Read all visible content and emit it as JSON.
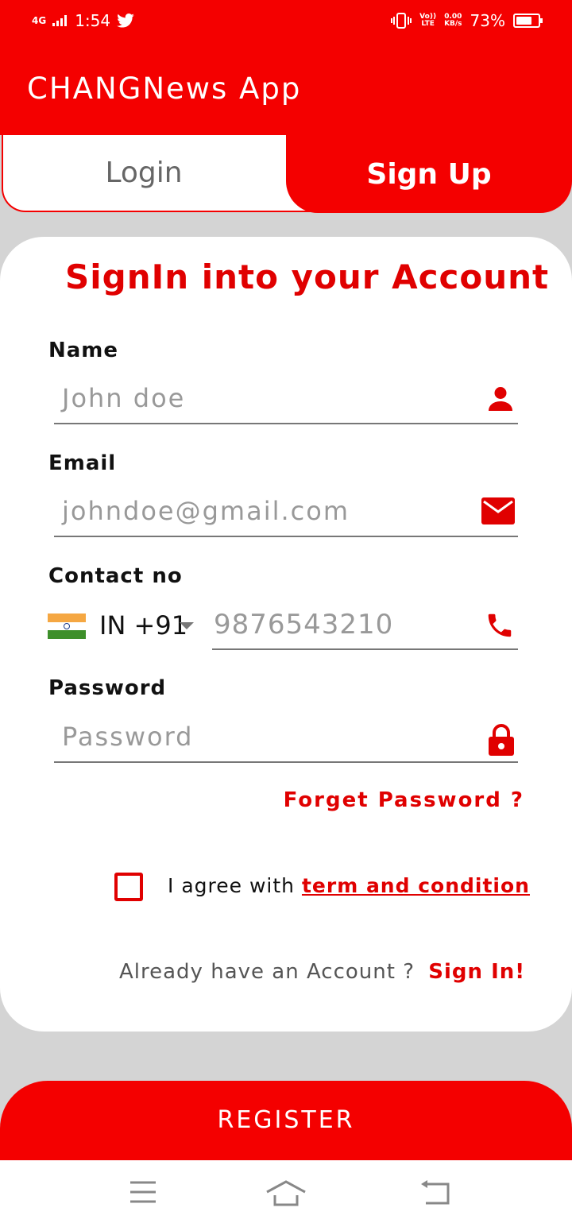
{
  "status_bar": {
    "network": "4G",
    "time": "1:54",
    "volte_top": "Vo))",
    "volte_bottom": "LTE",
    "speed_top": "0.00",
    "speed_bottom": "KB/s",
    "battery": "73%",
    "battery_level": 0.73
  },
  "app": {
    "title": "CHANGNews App"
  },
  "tabs": [
    {
      "label": "Login"
    },
    {
      "label": "Sign Up"
    }
  ],
  "form": {
    "title": "SignIn into your Account",
    "name": {
      "label": "Name",
      "placeholder": "John doe"
    },
    "email": {
      "label": "Email",
      "placeholder": "johndoe@gmail.com"
    },
    "contact": {
      "label": "Contact no",
      "country_code": "IN +91",
      "placeholder": "9876543210"
    },
    "password": {
      "label": "Password",
      "placeholder": "Password"
    },
    "forgot": "Forget Password ?",
    "agree_text": "I agree with",
    "agree_link": "term and condition",
    "already_text": "Already have an Account ?",
    "signin_link": "Sign In!"
  },
  "register_button": "REGISTER",
  "colors": {
    "brand": "#f40000",
    "background": "#d4d4d4",
    "card": "#ffffff"
  },
  "icons": {
    "name_field": "person-icon",
    "email_field": "envelope-icon",
    "phone_field": "phone-icon",
    "password_field": "lock-icon",
    "nav": [
      "menu-icon",
      "home-icon",
      "back-icon"
    ]
  }
}
